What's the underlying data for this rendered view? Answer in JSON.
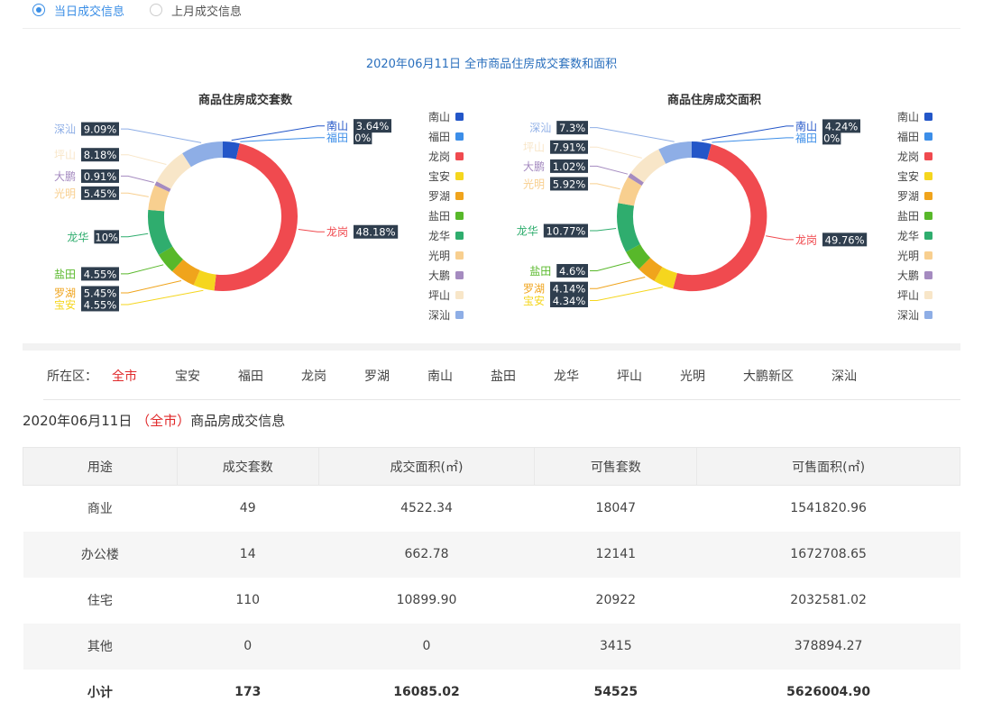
{
  "filters": {
    "today_label": "当日成交信息",
    "lastmonth_label": "上月成交信息"
  },
  "header": {
    "chart_title": "2020年06月11日 全市商品住房成交套数和面积"
  },
  "colors": {
    "南山": "#2356c8",
    "福田": "#3c8ee8",
    "龙岗": "#f04a4f",
    "宝安": "#f5d61e",
    "罗湖": "#f0a41c",
    "盐田": "#58b82a",
    "龙华": "#2fad6e",
    "光明": "#f8cf8f",
    "大鹏": "#a58bc0",
    "坪山": "#f8e6c8",
    "深汕": "#8eaee6"
  },
  "chart_data": [
    {
      "type": "pie",
      "title": "商品住房成交套数",
      "categories": [
        "南山",
        "福田",
        "龙岗",
        "宝安",
        "罗湖",
        "盐田",
        "龙华",
        "光明",
        "大鹏",
        "坪山",
        "深汕"
      ],
      "values": [
        3.64,
        0,
        48.18,
        4.55,
        5.45,
        4.55,
        10,
        5.45,
        0.91,
        8.18,
        9.09
      ],
      "labels": [
        "3.64%",
        "0%",
        "48.18%",
        "4.55%",
        "5.45%",
        "4.55%",
        "10%",
        "5.45%",
        "0.91%",
        "8.18%",
        "9.09%"
      ],
      "legend": [
        "南山",
        "福田",
        "龙岗",
        "宝安",
        "罗湖",
        "盐田",
        "龙华",
        "光明",
        "大鹏",
        "坪山",
        "深汕"
      ],
      "legend_position": "right"
    },
    {
      "type": "pie",
      "title": "商品住房成交面积",
      "categories": [
        "南山",
        "福田",
        "龙岗",
        "宝安",
        "罗湖",
        "盐田",
        "龙华",
        "光明",
        "大鹏",
        "坪山",
        "深汕"
      ],
      "values": [
        4.24,
        0,
        49.76,
        4.34,
        4.14,
        4.6,
        10.77,
        5.92,
        1.02,
        7.91,
        7.3
      ],
      "labels": [
        "4.24%",
        "0%",
        "49.76%",
        "4.34%",
        "4.14%",
        "4.6%",
        "10.77%",
        "5.92%",
        "1.02%",
        "7.91%",
        "7.3%"
      ],
      "legend": [
        "南山",
        "福田",
        "龙岗",
        "宝安",
        "罗湖",
        "盐田",
        "龙华",
        "光明",
        "大鹏",
        "坪山",
        "深汕"
      ],
      "legend_position": "right"
    }
  ],
  "districts": {
    "label": "所在区：",
    "items": [
      "全市",
      "宝安",
      "福田",
      "龙岗",
      "罗湖",
      "南山",
      "盐田",
      "龙华",
      "坪山",
      "光明",
      "大鹏新区",
      "深汕"
    ],
    "active": "全市"
  },
  "table": {
    "title_date": "2020年06月11日",
    "title_open": "（",
    "title_scope": "全市",
    "title_close": "）",
    "title_suffix": "商品房成交信息",
    "headers": [
      "用途",
      "成交套数",
      "成交面积(㎡)",
      "可售套数",
      "可售面积(㎡)"
    ],
    "rows": [
      [
        "商业",
        "49",
        "4522.34",
        "18047",
        "1541820.96"
      ],
      [
        "办公楼",
        "14",
        "662.78",
        "12141",
        "1672708.65"
      ],
      [
        "住宅",
        "110",
        "10899.90",
        "20922",
        "2032581.02"
      ],
      [
        "其他",
        "0",
        "0",
        "3415",
        "378894.27"
      ]
    ],
    "subtotal": [
      "小计",
      "173",
      "16085.02",
      "54525",
      "5626004.90"
    ]
  }
}
